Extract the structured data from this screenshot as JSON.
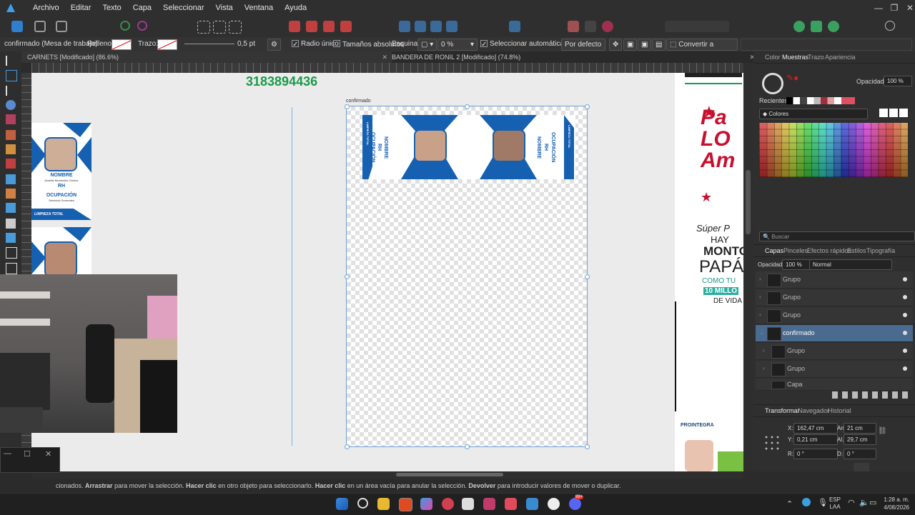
{
  "menubar": {
    "items": [
      "Archivo",
      "Editar",
      "Texto",
      "Capa",
      "Seleccionar",
      "Vista",
      "Ventana",
      "Ayuda"
    ]
  },
  "context": {
    "selection_label": "confirmado (Mesa de trabajo)",
    "fill_label": "Relleno:",
    "stroke_label": "Trazo:",
    "stroke_width": "0,5 pt",
    "single_radius": "Radio único",
    "absolute_sizes": "Tamaños absolutos",
    "corner_label": "Esquina:",
    "corner_value": "0 %",
    "auto_select": "Seleccionar automáticamente:",
    "auto_select_value": "Por defecto",
    "convert_curves": "Convertir a curvas"
  },
  "tabs": [
    {
      "label": "CARNETS [Modificado] (86.6%)"
    },
    {
      "label": "BANDERA DE RONIL 2 [Modificado] (74.8%)"
    }
  ],
  "canvas": {
    "phone": "3183894436",
    "artboard_name": "confirmado",
    "card_left": {
      "nombre": "NOMBRE",
      "rh": "RH",
      "ocupacion": "OCUPACIÓN",
      "footer": "LIMPIEZA TOTAL"
    },
    "left_card": {
      "nombre": "NOMBRE",
      "rh": "RH",
      "ocupacion": "OCUPACIÓN",
      "name_small": "Anabile Benavides Gómez",
      "job_small": "Servicios Generales",
      "footer": "LIMPIEZA TOTAL",
      "logo": "LT"
    },
    "right_texts": {
      "super": "Súper P",
      "hay": "HAY",
      "monto": "MONTO",
      "papa": "PAPÁ",
      "como": "COMO TU",
      "mill": "10 MILLO",
      "vida": "DE VIDA",
      "brand": "PROINTEGRA"
    }
  },
  "panels": {
    "top_tabs": [
      "Color",
      "Muestras",
      "Trazo",
      "Apariencia"
    ],
    "opacity_label": "Opacidad:",
    "opacity_value": "100 %",
    "recent_label": "Recientes:",
    "palette_name": "Colores",
    "search_placeholder": "Buscar",
    "layers_tabs": [
      "Capas",
      "Pinceles",
      "Efectos rápidos",
      "Estilos",
      "Tipografía"
    ],
    "layers_opacity_label": "Opacidad:",
    "layers_opacity": "100 %",
    "blend_mode": "Normal",
    "layers": [
      {
        "name": "Grupo"
      },
      {
        "name": "Grupo"
      },
      {
        "name": "Grupo"
      },
      {
        "name": "confirmado"
      },
      {
        "name": "Grupo"
      },
      {
        "name": "Grupo"
      },
      {
        "name": "Capa"
      }
    ],
    "transform_tabs": [
      "Transformar",
      "Navegador",
      "Historial"
    ],
    "transform": {
      "x_label": "X:",
      "x": "162,47 cm",
      "w_label": "An.:",
      "w": "21 cm",
      "y_label": "Y:",
      "y": "0,21 cm",
      "h_label": "Al.:",
      "h": "29,7 cm",
      "r_label": "R:",
      "r": "0 °",
      "s_label": "D:",
      "s": "0 °"
    },
    "accent": "#4a6a8f"
  },
  "status": {
    "pre": "cionados. ",
    "b1": "Arrastrar",
    "t1": " para mover la selección. ",
    "b2": "Hacer clic",
    "t2": " en otro objeto para seleccionarlo. ",
    "b3": "Hacer clic",
    "t3": " en un área vacía para anular la selección. ",
    "b4": "Devolver",
    "t4": " para introducir valores de mover o duplicar."
  },
  "taskbar": {
    "lang1": "ESP",
    "lang2": "LAA",
    "time": "1:28 a. m.",
    "date": "4/08/2026",
    "badge": "99+"
  }
}
